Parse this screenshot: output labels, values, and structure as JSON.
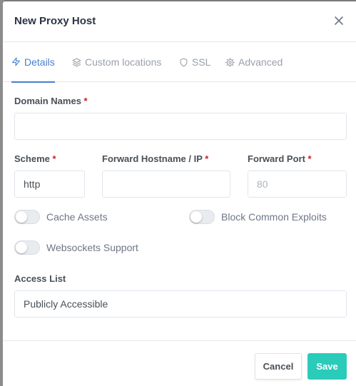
{
  "modal": {
    "title": "New Proxy Host"
  },
  "tabs": [
    {
      "label": "Details",
      "icon": "lightning-icon",
      "active": true
    },
    {
      "label": "Custom locations",
      "icon": "layers-icon",
      "active": false
    },
    {
      "label": "SSL",
      "icon": "shield-icon",
      "active": false
    },
    {
      "label": "Advanced",
      "icon": "gear-icon",
      "active": false
    }
  ],
  "form": {
    "domain_names": {
      "label": "Domain Names",
      "required_mark": "*",
      "value": ""
    },
    "scheme": {
      "label": "Scheme",
      "required_mark": "*",
      "value": "http"
    },
    "forward_host": {
      "label": "Forward Hostname / IP",
      "required_mark": "*",
      "value": ""
    },
    "forward_port": {
      "label": "Forward Port",
      "required_mark": "*",
      "value": "",
      "placeholder": "80"
    },
    "toggles": {
      "cache_assets": {
        "label": "Cache Assets",
        "checked": false
      },
      "block_exploits": {
        "label": "Block Common Exploits",
        "checked": false
      },
      "websockets": {
        "label": "Websockets Support",
        "checked": false
      }
    },
    "access_list": {
      "label": "Access List",
      "value": "Publicly Accessible"
    }
  },
  "footer": {
    "cancel_label": "Cancel",
    "save_label": "Save"
  },
  "colors": {
    "accent": "#467fcf",
    "save": "#2bcbba",
    "required": "#cd201f"
  }
}
